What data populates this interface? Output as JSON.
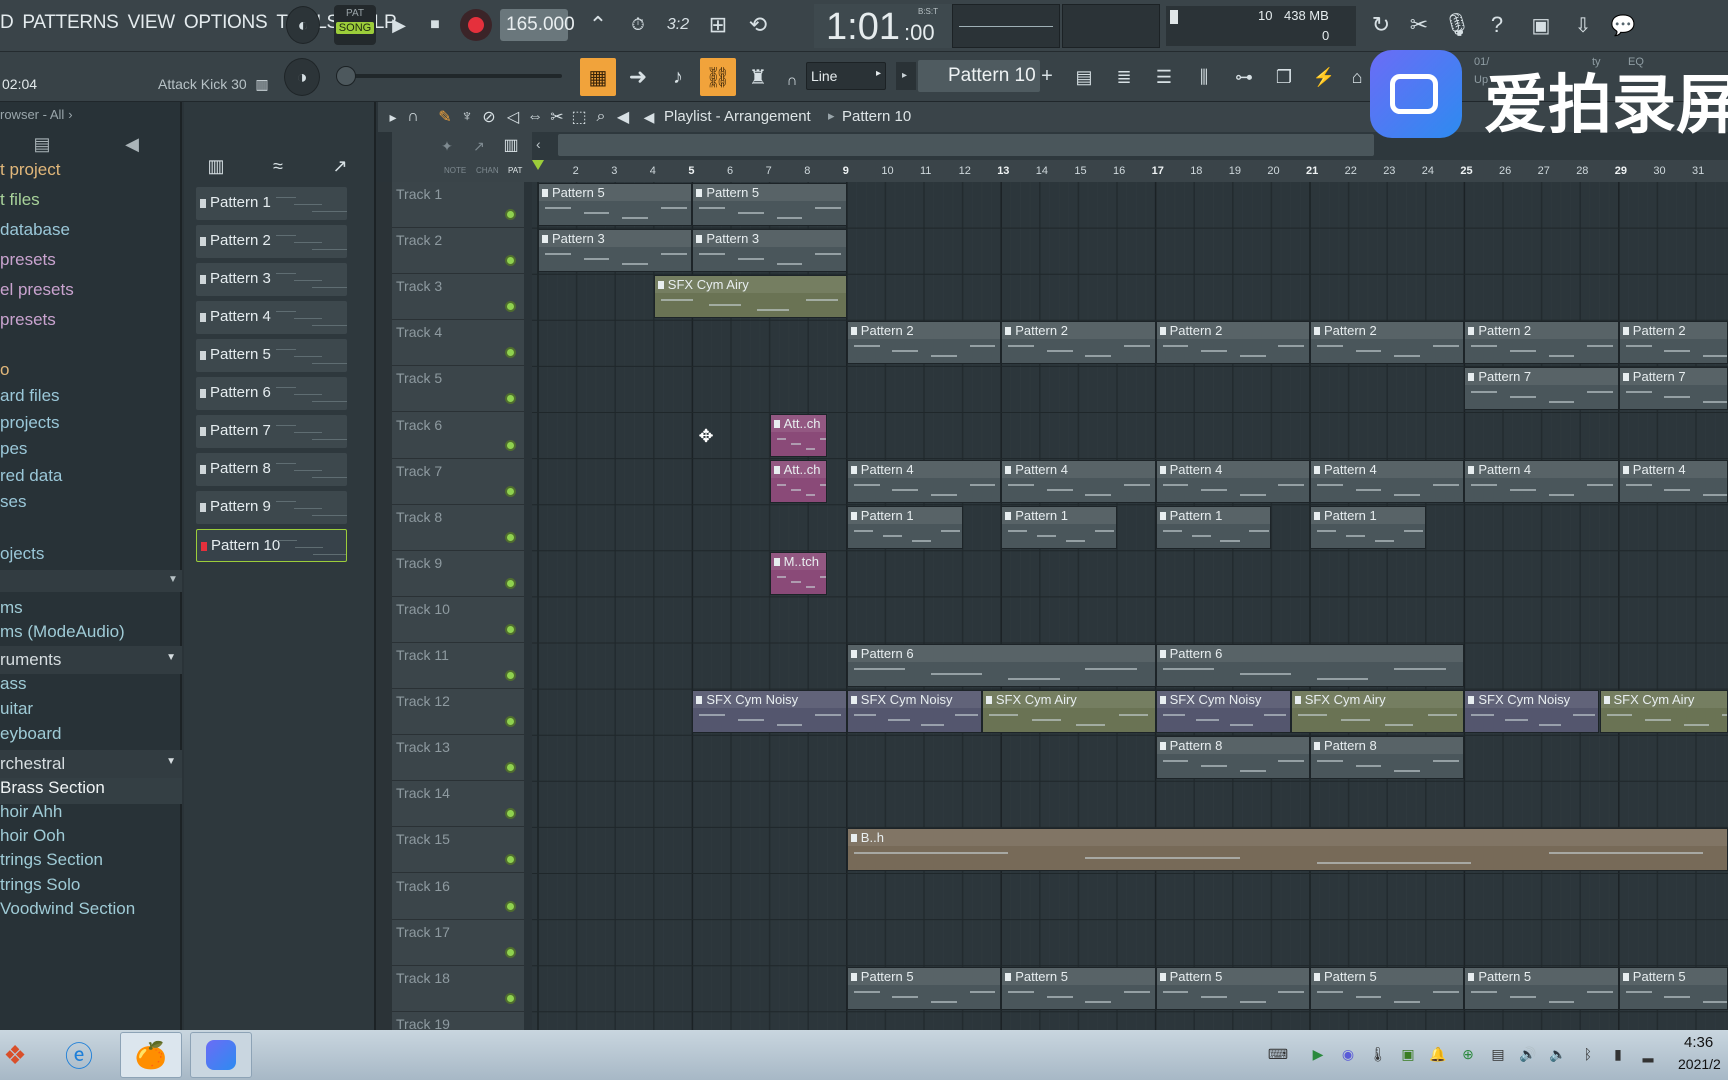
{
  "menu": [
    "D",
    "PATTERNS",
    "VIEW",
    "OPTIONS",
    "TOOLS",
    "HELP"
  ],
  "transport": {
    "pat_label": "PAT",
    "song_label": "SONG",
    "tempo": "165.000",
    "time": "1:01",
    "time_sub": ":00",
    "time_label": "B:S:T"
  },
  "memory": {
    "cpu": "10",
    "mem": "438 MB",
    "poly": "0"
  },
  "hint": {
    "time": "02:04",
    "name": "Attack Kick 30"
  },
  "snap": {
    "mode": "Line",
    "pattern": "Pattern 10",
    "plus": "+"
  },
  "recorder_info": {
    "line1": "01/",
    "line2": "Up",
    "line3": "ty",
    "line4": "EQ"
  },
  "watermark": {
    "text": "爱拍录屏"
  },
  "browser": {
    "title": "rowser - All",
    "items": [
      {
        "label": "t project",
        "color": "#e1b77a"
      },
      {
        "label": "t files",
        "color": "#a8d29a"
      },
      {
        "label": "database",
        "color": "#9ac7d8"
      },
      {
        "label": "presets",
        "color": "#c9a3cf"
      },
      {
        "label": "el presets",
        "color": "#c9a3cf"
      },
      {
        "label": "presets",
        "color": "#c9a3cf"
      },
      {
        "label": "o",
        "color": "#e1b77a"
      },
      {
        "label": "ard files",
        "color": "#9ac7d8"
      },
      {
        "label": "projects",
        "color": "#9ac7d8"
      },
      {
        "label": "pes",
        "color": "#9ac7d8"
      },
      {
        "label": "red data",
        "color": "#9ac7d8"
      },
      {
        "label": "ses",
        "color": "#9ac7d8"
      },
      {
        "label": "ojects",
        "color": "#9ac7d8"
      }
    ],
    "lower": [
      {
        "label": "ms",
        "type": "item"
      },
      {
        "label": "ms (ModeAudio)",
        "type": "item"
      },
      {
        "label": "ruments",
        "type": "cat"
      },
      {
        "label": "ass",
        "type": "item"
      },
      {
        "label": "uitar",
        "type": "item"
      },
      {
        "label": "eyboard",
        "type": "item"
      },
      {
        "label": "rchestral",
        "type": "cat"
      },
      {
        "label": "Brass Section",
        "type": "sel"
      },
      {
        "label": "hoir Ahh",
        "type": "item"
      },
      {
        "label": "hoir Ooh",
        "type": "item"
      },
      {
        "label": "trings Section",
        "type": "item"
      },
      {
        "label": "trings Solo",
        "type": "item"
      },
      {
        "label": "Voodwind Section",
        "type": "item"
      }
    ]
  },
  "patterns": [
    "Pattern 1",
    "Pattern 2",
    "Pattern 3",
    "Pattern 4",
    "Pattern 5",
    "Pattern 6",
    "Pattern 7",
    "Pattern 8",
    "Pattern 9",
    "Pattern 10"
  ],
  "pattern_add": "+",
  "playlist": {
    "title": "Playlist - Arrangement",
    "crumb": "Pattern 10",
    "tabs": [
      "NOTE",
      "CHAN",
      "PAT"
    ]
  },
  "ruler": [
    "2",
    "3",
    "4",
    "5",
    "6",
    "7",
    "8",
    "9",
    "10",
    "11",
    "12",
    "13",
    "14",
    "15",
    "16",
    "17",
    "18",
    "19",
    "20",
    "21",
    "22",
    "23",
    "24",
    "25",
    "26",
    "27",
    "28",
    "29",
    "30",
    "31"
  ],
  "tracks": [
    "Track 1",
    "Track 2",
    "Track 3",
    "Track 4",
    "Track 5",
    "Track 6",
    "Track 7",
    "Track 8",
    "Track 9",
    "Track 10",
    "Track 11",
    "Track 12",
    "Track 13",
    "Track 14",
    "Track 15",
    "Track 16",
    "Track 17",
    "Track 18",
    "Track 19"
  ],
  "clips": [
    {
      "t": 0,
      "bar": 1,
      "len": 4,
      "label": "Pattern 5",
      "color": "#4a565b"
    },
    {
      "t": 0,
      "bar": 5,
      "len": 4,
      "label": "Pattern 5",
      "color": "#4a565b"
    },
    {
      "t": 1,
      "bar": 1,
      "len": 4,
      "label": "Pattern 3",
      "color": "#4a565b"
    },
    {
      "t": 1,
      "bar": 5,
      "len": 4,
      "label": "Pattern 3",
      "color": "#4a565b"
    },
    {
      "t": 2,
      "bar": 4,
      "len": 5,
      "label": "SFX Cym Airy",
      "color": "#6a7354"
    },
    {
      "t": 3,
      "bar": 9,
      "len": 4,
      "label": "Pattern 2",
      "color": "#4a565b"
    },
    {
      "t": 3,
      "bar": 13,
      "len": 4,
      "label": "Pattern 2",
      "color": "#4a565b"
    },
    {
      "t": 3,
      "bar": 17,
      "len": 4,
      "label": "Pattern 2",
      "color": "#4a565b"
    },
    {
      "t": 3,
      "bar": 21,
      "len": 4,
      "label": "Pattern 2",
      "color": "#4a565b"
    },
    {
      "t": 3,
      "bar": 25,
      "len": 4,
      "label": "Pattern 2",
      "color": "#4a565b"
    },
    {
      "t": 3,
      "bar": 29,
      "len": 4,
      "label": "Pattern 2",
      "color": "#4a565b"
    },
    {
      "t": 4,
      "bar": 25,
      "len": 4,
      "label": "Pattern 7",
      "color": "#4a565b"
    },
    {
      "t": 4,
      "bar": 29,
      "len": 4,
      "label": "Pattern 7",
      "color": "#4a565b"
    },
    {
      "t": 5,
      "bar": 7,
      "len": 1.5,
      "label": "Att..ch",
      "color": "#8a4a78"
    },
    {
      "t": 6,
      "bar": 7,
      "len": 1.5,
      "label": "Att..ch",
      "color": "#8a4a78"
    },
    {
      "t": 6,
      "bar": 9,
      "len": 4,
      "label": "Pattern 4",
      "color": "#4a565b"
    },
    {
      "t": 6,
      "bar": 13,
      "len": 4,
      "label": "Pattern 4",
      "color": "#4a565b"
    },
    {
      "t": 6,
      "bar": 17,
      "len": 4,
      "label": "Pattern 4",
      "color": "#4a565b"
    },
    {
      "t": 6,
      "bar": 21,
      "len": 4,
      "label": "Pattern 4",
      "color": "#4a565b"
    },
    {
      "t": 6,
      "bar": 25,
      "len": 4,
      "label": "Pattern 4",
      "color": "#4a565b"
    },
    {
      "t": 6,
      "bar": 29,
      "len": 4,
      "label": "Pattern 4",
      "color": "#4a565b"
    },
    {
      "t": 7,
      "bar": 9,
      "len": 3,
      "label": "Pattern 1",
      "color": "#4a565b"
    },
    {
      "t": 7,
      "bar": 13,
      "len": 3,
      "label": "Pattern 1",
      "color": "#4a565b"
    },
    {
      "t": 7,
      "bar": 17,
      "len": 3,
      "label": "Pattern 1",
      "color": "#4a565b"
    },
    {
      "t": 7,
      "bar": 21,
      "len": 3,
      "label": "Pattern 1",
      "color": "#4a565b"
    },
    {
      "t": 8,
      "bar": 7,
      "len": 1.5,
      "label": "M..tch",
      "color": "#8a4a78"
    },
    {
      "t": 10,
      "bar": 9,
      "len": 8,
      "label": "Pattern 6",
      "color": "#4a565b"
    },
    {
      "t": 10,
      "bar": 17,
      "len": 8,
      "label": "Pattern 6",
      "color": "#4a565b"
    },
    {
      "t": 11,
      "bar": 5,
      "len": 4,
      "label": "SFX Cym Noisy",
      "color": "#54566e"
    },
    {
      "t": 11,
      "bar": 9,
      "len": 3.5,
      "label": "SFX Cym Noisy",
      "color": "#54566e"
    },
    {
      "t": 11,
      "bar": 12.5,
      "len": 4.5,
      "label": "SFX Cym Airy",
      "color": "#6a7354"
    },
    {
      "t": 11,
      "bar": 17,
      "len": 3.5,
      "label": "SFX Cym Noisy",
      "color": "#54566e"
    },
    {
      "t": 11,
      "bar": 20.5,
      "len": 4.5,
      "label": "SFX Cym Airy",
      "color": "#6a7354"
    },
    {
      "t": 11,
      "bar": 25,
      "len": 3.5,
      "label": "SFX Cym Noisy",
      "color": "#54566e"
    },
    {
      "t": 11,
      "bar": 28.5,
      "len": 4,
      "label": "SFX Cym Airy",
      "color": "#6a7354"
    },
    {
      "t": 12,
      "bar": 17,
      "len": 4,
      "label": "Pattern 8",
      "color": "#4a565b"
    },
    {
      "t": 12,
      "bar": 21,
      "len": 4,
      "label": "Pattern 8",
      "color": "#4a565b"
    },
    {
      "t": 14,
      "bar": 9,
      "len": 24,
      "label": "B..h",
      "color": "#776a58"
    },
    {
      "t": 17,
      "bar": 9,
      "len": 4,
      "label": "Pattern 5",
      "color": "#4a565b"
    },
    {
      "t": 17,
      "bar": 13,
      "len": 4,
      "label": "Pattern 5",
      "color": "#4a565b"
    },
    {
      "t": 17,
      "bar": 17,
      "len": 4,
      "label": "Pattern 5",
      "color": "#4a565b"
    },
    {
      "t": 17,
      "bar": 21,
      "len": 4,
      "label": "Pattern 5",
      "color": "#4a565b"
    },
    {
      "t": 17,
      "bar": 25,
      "len": 4,
      "label": "Pattern 5",
      "color": "#4a565b"
    },
    {
      "t": 17,
      "bar": 29,
      "len": 4,
      "label": "Pattern 5",
      "color": "#4a565b"
    }
  ],
  "taskbar": {
    "clock": "4:36",
    "date": "2021/2"
  }
}
